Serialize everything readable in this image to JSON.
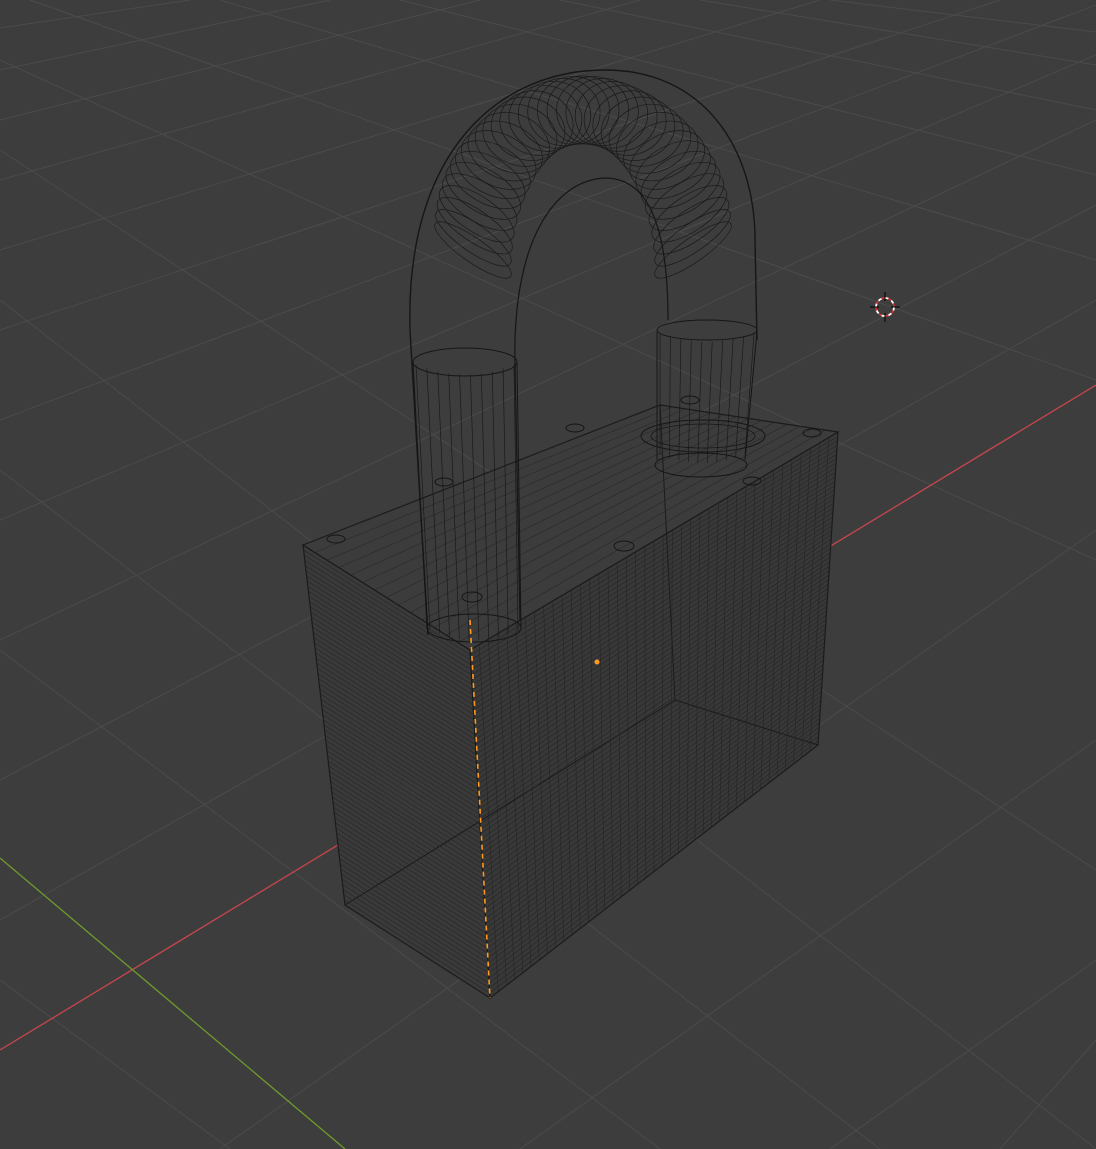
{
  "app": {
    "title": ""
  },
  "viewport": {
    "mode": "3d-viewport",
    "shading": "wireframe",
    "background_color": "#3d3d3d",
    "grid": {
      "visible": true,
      "line_color": "#4a4a4a"
    },
    "axes": {
      "x_axis_color": "#c8464e",
      "y_axis_color": "#6f9a2c"
    },
    "scene_objects": [
      {
        "name": "padlock-body",
        "type": "mesh",
        "display": "wireframe",
        "wire_color": "#141414"
      },
      {
        "name": "padlock-shackle",
        "type": "mesh",
        "display": "wireframe",
        "wire_color": "#141414"
      }
    ],
    "selection": {
      "selected_edge_color": "#ff9a1f",
      "origin_color": "#ff9a1f"
    },
    "cursor_icon": "3d-cursor-icon"
  }
}
